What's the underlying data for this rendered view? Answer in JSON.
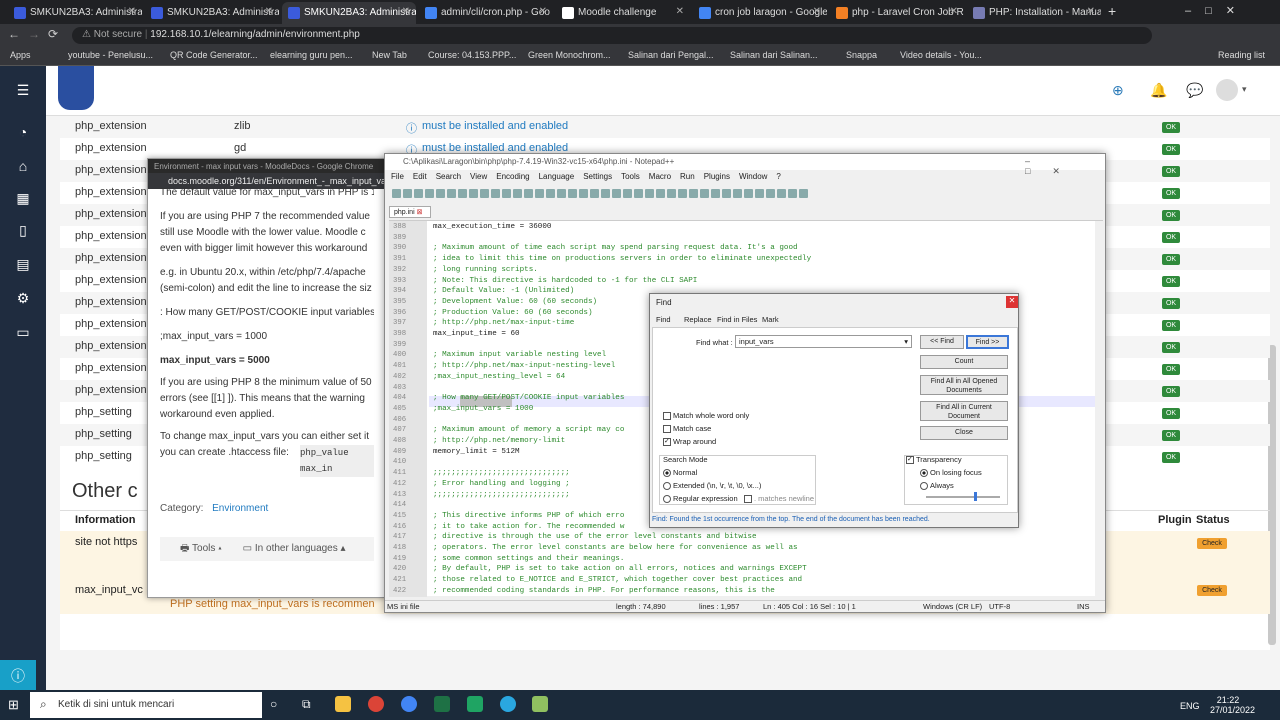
{
  "browser": {
    "tabs": [
      {
        "title": "SMKUN2BA3: Administrati"
      },
      {
        "title": "SMKUN2BA3: Administrati"
      },
      {
        "title": "SMKUN2BA3: Administrati"
      },
      {
        "title": "admin/cli/cron.php - Goo"
      },
      {
        "title": "Moodle challenge"
      },
      {
        "title": "cron job laragon - Google"
      },
      {
        "title": "php - Laravel Cron Job Ru"
      },
      {
        "title": "PHP: Installation - Manual"
      }
    ],
    "not_secure": "Not secure",
    "url": "192.168.10.1/elearning/admin/environment.php",
    "bookmarks": [
      "Apps",
      "youtube - Penelusu...",
      "QR Code Generator...",
      "elearning guru pen...",
      "New Tab",
      "Course: 04.153.PPP...",
      "Green Monochrom...",
      "Salinan dari Pengal...",
      "Salinan dari Salinan...",
      "Snappa",
      "Video details - You..."
    ],
    "reading_list": "Reading list"
  },
  "moodle": {
    "rows": [
      {
        "name": "php_extension",
        "info": "zlib",
        "msg": "must be installed and enabled",
        "status": "OK"
      },
      {
        "name": "php_extension",
        "info": "gd",
        "msg": "must be installed and enabled",
        "status": "OK"
      },
      {
        "name": "php_extension",
        "status": "OK"
      },
      {
        "name": "php_extension",
        "status": "OK"
      },
      {
        "name": "php_extension",
        "status": "OK"
      },
      {
        "name": "php_extension",
        "status": "OK"
      },
      {
        "name": "php_extension",
        "status": "OK"
      },
      {
        "name": "php_extension",
        "status": "OK"
      },
      {
        "name": "php_extension",
        "status": "OK"
      },
      {
        "name": "php_extension",
        "status": "OK"
      },
      {
        "name": "php_extension",
        "status": "OK"
      },
      {
        "name": "php_extension",
        "status": "OK"
      },
      {
        "name": "php_extension",
        "status": "OK"
      },
      {
        "name": "php_setting",
        "status": "OK"
      },
      {
        "name": "php_setting",
        "status": "OK"
      },
      {
        "name": "php_setting",
        "status": "OK"
      }
    ],
    "other_heading": "Other c",
    "col_information": "Information",
    "col_plugin": "Plugin",
    "col_status": "Status",
    "site_row": "site not https",
    "check": "Check",
    "maxvars_row": "max_input_vc",
    "warning": "PHP setting max_input_vars is recommen"
  },
  "docs": {
    "title": "Environment - max input vars - MoodleDocs - Google Chrome",
    "url": "docs.moodle.org/311/en/Environment_-_max_input_vars",
    "p0": "The default value for max_input_vars in PHP is 1",
    "p1": "If you are using PHP 7 the recommended value still use Moodle with the lower value. Moodle c even with bigger limit however this workaround",
    "p2": "e.g. in Ubuntu 20.x, within /etc/php/7.4/apache (semi-colon) and edit the line to increase the siz",
    "p3": ": How many GET/POST/COOKIE input variables",
    "p4": ";max_input_vars = 1000",
    "p5": "max_input_vars = 5000",
    "p6": "If you are using PHP 8 the minimum value of 50 errors (see [[1] ]). This means that the warning workaround even applied.",
    "p7": "To change max_input_vars you can either set it you can create .htaccess file:",
    "code": "php_value max_in",
    "category_label": "Category:",
    "category": "Environment",
    "tools": "Tools",
    "languages": "In other languages"
  },
  "npp": {
    "title": "C:\\Aplikasi\\Laragon\\bin\\php\\php-7.4.19-Win32-vc15-x64\\php.ini - Notepad++",
    "menu": [
      "File",
      "Edit",
      "Search",
      "View",
      "Encoding",
      "Language",
      "Settings",
      "Tools",
      "Macro",
      "Run",
      "Plugins",
      "Window",
      "?"
    ],
    "tab": "php.ini",
    "lines": [
      {
        "n": "388",
        "t": "max_execution_time = 36000",
        "c": false
      },
      {
        "n": "389",
        "t": "",
        "c": false
      },
      {
        "n": "390",
        "t": "; Maximum amount of time each script may spend parsing request data. It's a good",
        "c": true
      },
      {
        "n": "391",
        "t": "; idea to limit this time on productions servers in order to eliminate unexpectedly",
        "c": true
      },
      {
        "n": "392",
        "t": "; long running scripts.",
        "c": true
      },
      {
        "n": "393",
        "t": "; Note: This directive is hardcoded to -1 for the CLI SAPI",
        "c": true
      },
      {
        "n": "394",
        "t": "; Default Value: -1 (Unlimited)",
        "c": true
      },
      {
        "n": "395",
        "t": "; Development Value: 60 (60 seconds)",
        "c": true
      },
      {
        "n": "396",
        "t": "; Production Value: 60 (60 seconds)",
        "c": true
      },
      {
        "n": "397",
        "t": "; http://php.net/max-input-time",
        "c": true
      },
      {
        "n": "398",
        "t": "max_input_time = 60",
        "c": false
      },
      {
        "n": "399",
        "t": "",
        "c": false
      },
      {
        "n": "400",
        "t": "; Maximum input variable nesting level",
        "c": true
      },
      {
        "n": "401",
        "t": "; http://php.net/max-input-nesting-level",
        "c": true
      },
      {
        "n": "402",
        "t": ";max_input_nesting_level = 64",
        "c": true
      },
      {
        "n": "403",
        "t": "",
        "c": false
      },
      {
        "n": "404",
        "t": "; How many GET/POST/COOKIE input variables",
        "c": true
      },
      {
        "n": "405",
        "t": ";max_input_vars = 1000",
        "c": true
      },
      {
        "n": "406",
        "t": "",
        "c": false
      },
      {
        "n": "407",
        "t": "; Maximum amount of memory a script may co",
        "c": true
      },
      {
        "n": "408",
        "t": "; http://php.net/memory-limit",
        "c": true
      },
      {
        "n": "409",
        "t": "memory_limit = 512M",
        "c": false
      },
      {
        "n": "410",
        "t": "",
        "c": false
      },
      {
        "n": "411",
        "t": ";;;;;;;;;;;;;;;;;;;;;;;;;;;;;;",
        "c": true
      },
      {
        "n": "412",
        "t": "; Error handling and logging ;",
        "c": true
      },
      {
        "n": "413",
        "t": ";;;;;;;;;;;;;;;;;;;;;;;;;;;;;;",
        "c": true
      },
      {
        "n": "414",
        "t": "",
        "c": false
      },
      {
        "n": "415",
        "t": "; This directive informs PHP of which erro",
        "c": true
      },
      {
        "n": "416",
        "t": "; it to take action for. The recommended w",
        "c": true
      },
      {
        "n": "417",
        "t": "; directive is through the use of the error level constants and bitwise",
        "c": true
      },
      {
        "n": "418",
        "t": "; operators. The error level constants are below here for convenience as well as",
        "c": true
      },
      {
        "n": "419",
        "t": "; some common settings and their meanings.",
        "c": true
      },
      {
        "n": "420",
        "t": "; By default, PHP is set to take action on all errors, notices and warnings EXCEPT",
        "c": true
      },
      {
        "n": "421",
        "t": "; those related to E_NOTICE and E_STRICT, which together cover best practices and",
        "c": true
      },
      {
        "n": "422",
        "t": "; recommended coding standards in PHP. For performance reasons, this is the",
        "c": true
      }
    ],
    "status": {
      "type": "MS ini file",
      "length": "length : 74,890",
      "lines": "lines : 1,957",
      "pos": "Ln : 405   Col : 16   Sel : 10 | 1",
      "eol": "Windows (CR LF)",
      "enc": "UTF-8",
      "mode": "INS"
    }
  },
  "find": {
    "title": "Find",
    "tabs": [
      "Find",
      "Replace",
      "Find in Files",
      "Mark"
    ],
    "find_what_label": "Find what :",
    "find_what": "input_vars",
    "btn_prev": "<< Find",
    "btn_next": "Find >>",
    "btn_count": "Count",
    "btn_all_opened": "Find All in All Opened Documents",
    "btn_all_current": "Find All in Current Document",
    "btn_close": "Close",
    "match_whole": "Match whole word only",
    "match_case": "Match case",
    "wrap": "Wrap around",
    "search_mode": "Search Mode",
    "mode_normal": "Normal",
    "mode_extended": "Extended (\\n, \\r, \\t, \\0, \\x...)",
    "mode_regex": "Regular expression",
    "matches_newline": ". matches newline",
    "transparency": "Transparency",
    "on_losing_focus": "On losing focus",
    "always": "Always",
    "status": "Find: Found the 1st occurrence from the top. The end of the document has been reached."
  },
  "taskbar": {
    "search": "Ketik di sini untuk mencari",
    "lang": "ENG",
    "time": "21:22",
    "date": "27/01/2022"
  }
}
